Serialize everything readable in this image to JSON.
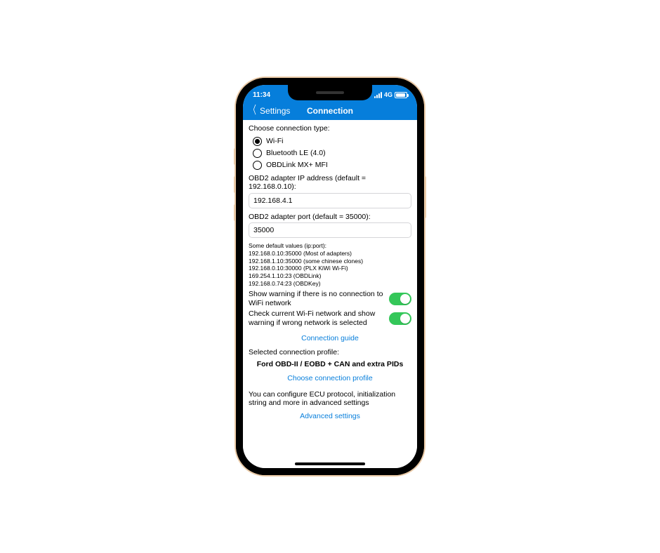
{
  "status": {
    "time": "11:34",
    "network_label": "4G"
  },
  "nav": {
    "back_label": "Settings",
    "title": "Connection"
  },
  "connection_type": {
    "label": "Choose connection type:",
    "options": [
      {
        "label": "Wi-Fi",
        "selected": true
      },
      {
        "label": "Bluetooth LE (4.0)",
        "selected": false
      },
      {
        "label": "OBDLink MX+ MFI",
        "selected": false
      }
    ]
  },
  "ip": {
    "label": "OBD2 adapter IP address (default = 192.168.0.10):",
    "value": "192.168.4.1"
  },
  "port": {
    "label": "OBD2 adapter port (default = 35000):",
    "value": "35000"
  },
  "defaults_hint": {
    "title": "Some default values (ip:port):",
    "lines": [
      "192.168.0.10:35000 (Most of adapters)",
      "192.168.1.10:35000 (some chinese clones)",
      "192.168.0.10:30000 (PLX KiWi Wi-Fi)",
      "169.254.1.10:23 (OBDLink)",
      "192.168.0.74:23 (OBDKey)"
    ]
  },
  "toggles": {
    "no_wifi_warning": {
      "label": "Show warning if there is no connection to WiFi network",
      "on": true
    },
    "wrong_network_warning": {
      "label": "Check current Wi-Fi network and show warning if wrong network is selected",
      "on": true
    }
  },
  "links": {
    "connection_guide": "Connection guide",
    "choose_profile": "Choose connection profile",
    "advanced": "Advanced settings"
  },
  "profile": {
    "label": "Selected connection profile:",
    "value": "Ford OBD-II / EOBD + CAN and extra PIDs"
  },
  "advanced_desc": "You can configure ECU protocol, initialization string and more in advanced settings"
}
